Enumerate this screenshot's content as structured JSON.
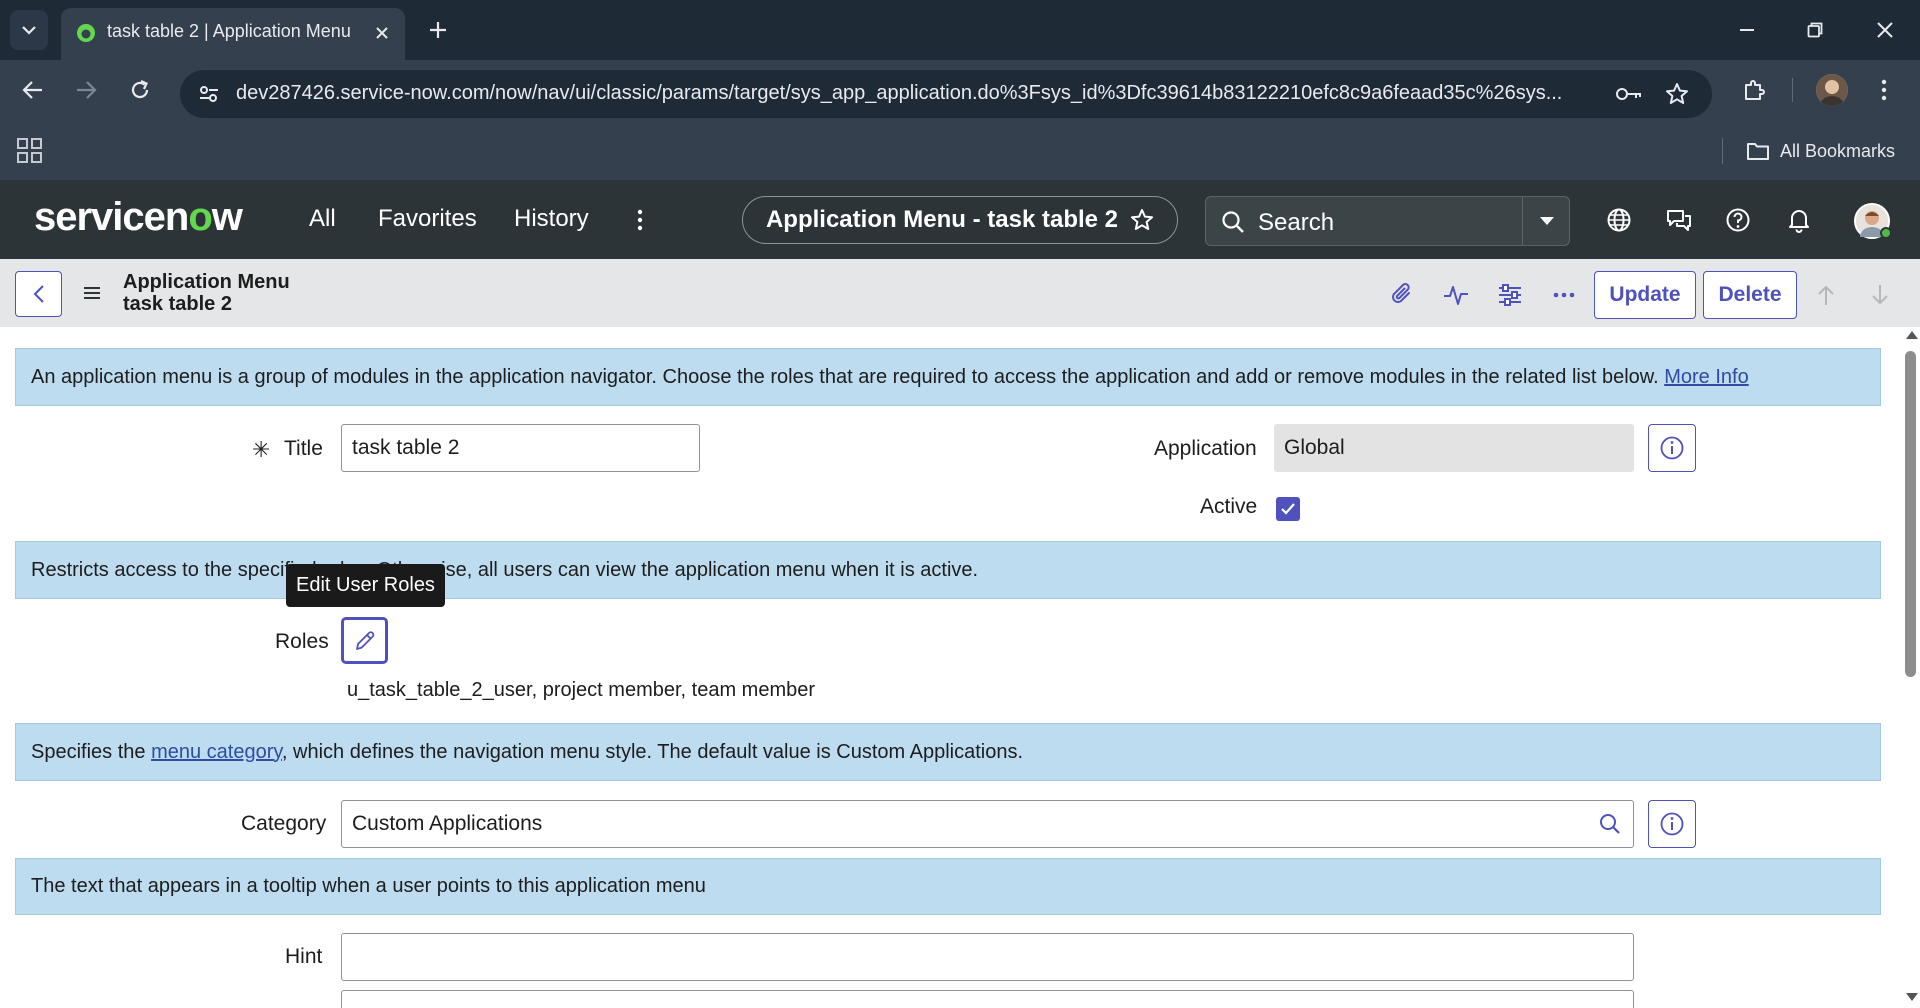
{
  "browser": {
    "tab_title": "task table 2 | Application Menu",
    "url": "dev287426.service-now.com/now/nav/ui/classic/params/target/sys_app_application.do%3Fsys_id%3Dfc39614b83122210efc8c9a6feaad35c%26sys...",
    "all_bookmarks_label": "All Bookmarks"
  },
  "sn_header": {
    "nav_all": "All",
    "nav_favorites": "Favorites",
    "nav_history": "History",
    "context_title": "Application Menu - task table 2",
    "search_placeholder": "Search"
  },
  "form_header": {
    "title_line1": "Application Menu",
    "title_line2": "task table 2",
    "update_label": "Update",
    "delete_label": "Delete"
  },
  "form": {
    "intro_text": "An application menu is a group of modules in the application navigator. Choose the roles that are required to access the application and add or remove modules in the related list below.",
    "intro_link": "More Info",
    "title_required_mark": "✳",
    "title_label": "Title",
    "title_value": "task table 2",
    "application_label": "Application",
    "application_value": "Global",
    "active_label": "Active",
    "active_checked": true,
    "roles_annotation": "Restricts access to the specified roles. Otherwise, all users can view the application menu when it is active.",
    "roles_tooltip": "Edit User Roles",
    "roles_label": "Roles",
    "roles_value": "u_task_table_2_user, project member, team member",
    "category_annotation_before": "Specifies the ",
    "category_annotation_link": "menu category",
    "category_annotation_after": ", which defines the navigation menu style. The default value is Custom Applications.",
    "category_label": "Category",
    "category_value": "Custom Applications",
    "hint_annotation": "The text that appears in a tooltip when a user points to this application menu",
    "hint_label": "Hint",
    "hint_value": ""
  },
  "colors": {
    "accent": "#4f52bd",
    "annotation_bg": "#bddcf0",
    "sn_header_bg": "#2d3437",
    "brand_green": "#62d84e"
  }
}
